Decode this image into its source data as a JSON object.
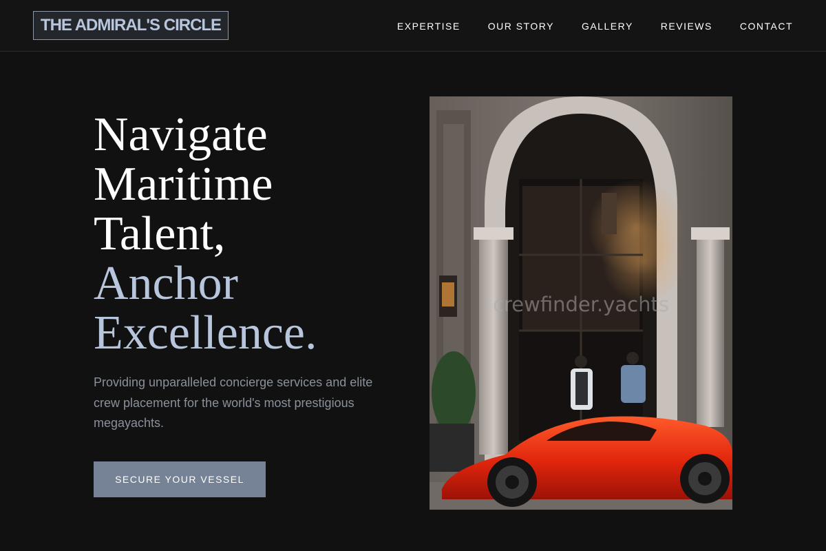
{
  "brand": {
    "name": "THE ADMIRAL'S CIRCLE"
  },
  "nav": {
    "items": [
      "EXPERTISE",
      "OUR STORY",
      "GALLERY",
      "REVIEWS",
      "CONTACT"
    ]
  },
  "hero": {
    "headline_lines": [
      "Navigate",
      "Maritime",
      "Talent,"
    ],
    "headline_accent_lines": [
      "Anchor",
      "Excellence."
    ],
    "subtitle": "Providing unparalleled concierge services and elite crew placement for the world's most prestigious megayachts.",
    "cta_label": "SECURE YOUR VESSEL",
    "image": {
      "watermark": "crewfinder.yachts",
      "icon": "hotel-entrance-red-sports-car-photo"
    }
  },
  "colors": {
    "background": "#111111",
    "accent": "#b7c6dd",
    "button": "#768396",
    "muted_text": "#8a919b"
  }
}
